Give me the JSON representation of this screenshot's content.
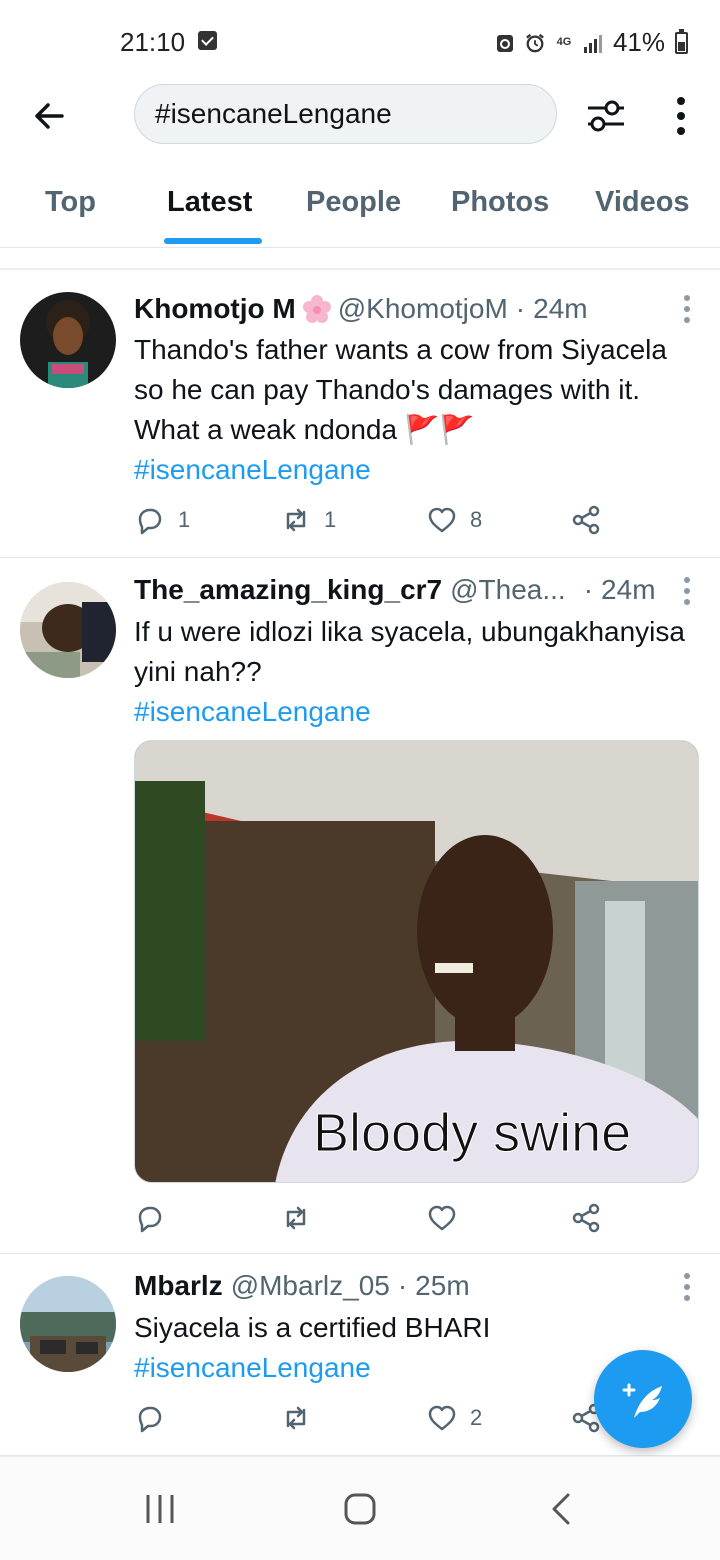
{
  "status_bar": {
    "time": "21:10",
    "battery": "41%",
    "network": "4G"
  },
  "search": {
    "query": "#isencaneLengane"
  },
  "tabs": [
    {
      "label": "Top"
    },
    {
      "label": "Latest",
      "active": true
    },
    {
      "label": "People"
    },
    {
      "label": "Photos"
    },
    {
      "label": "Videos"
    }
  ],
  "tweets": [
    {
      "name": "Khomotjo M",
      "handle": "@KhomotjoM",
      "time": "24m",
      "text": "Thando's father wants a cow from Siyacela so he can pay Thando's damages with it. What a weak ndonda 🚩🚩",
      "hashtag": "#isencaneLengane",
      "replies": "1",
      "retweets": "1",
      "likes": "8"
    },
    {
      "name": "The_amazing_king_cr7",
      "handle": "@Thea...",
      "time": "24m",
      "text": "If u were idlozi lika syacela, ubungakhanyisa yini nah??",
      "hashtag": "#isencaneLengane",
      "media_caption": "Bloody swine"
    },
    {
      "name": "Mbarlz",
      "handle": "@Mbarlz_05",
      "time": "25m",
      "text": "Siyacela is a certified BHARI",
      "hashtag": "#isencaneLengane",
      "likes": "2"
    }
  ],
  "colors": {
    "accent": "#1d9bf0",
    "text": "#0f1419",
    "secondary": "#536471"
  }
}
